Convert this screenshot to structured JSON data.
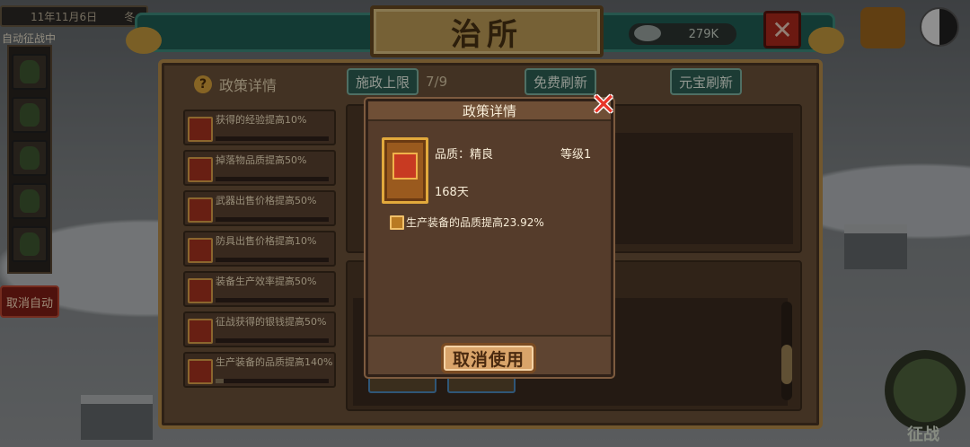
{
  "top_bar": {
    "date": "11年11月6日",
    "season": "冬",
    "resource_left": "279K",
    "auto_label": "自动征战中",
    "cancel_auto": "取消自动"
  },
  "header": {
    "title": "治所",
    "silver": "279K",
    "close": "✕"
  },
  "panel": {
    "help_label": "政策详情",
    "limit_button": "施政上限",
    "limit_value": "7/9",
    "free_refresh": "免费刷新",
    "gold_refresh": "元宝刷新"
  },
  "policies": [
    {
      "text": "获得的经验提高10%",
      "progress": 0
    },
    {
      "text": "掉落物品质提高50%",
      "progress": 0
    },
    {
      "text": "武器出售价格提高50%",
      "progress": 0
    },
    {
      "text": "防具出售价格提高10%",
      "progress": 0
    },
    {
      "text": "装备生产效率提高50%",
      "progress": 0
    },
    {
      "text": "征战获得的银钱提高50%",
      "progress": 0
    },
    {
      "text": "生产装备的品质提高140%",
      "progress": 0.07
    }
  ],
  "dialog": {
    "title": "政策详情",
    "quality": "品质：精良",
    "level": "等级1",
    "duration": "168天",
    "effect": "生产装备的品质提高23.92%",
    "cancel_use": "取消使用"
  },
  "battle": {
    "label": "征战"
  },
  "colors": {
    "dialog_bg": "#553c2b",
    "close_red": "#e8352a",
    "button_tan": "#d9a46a",
    "banner_teal": "#1f5e54"
  }
}
